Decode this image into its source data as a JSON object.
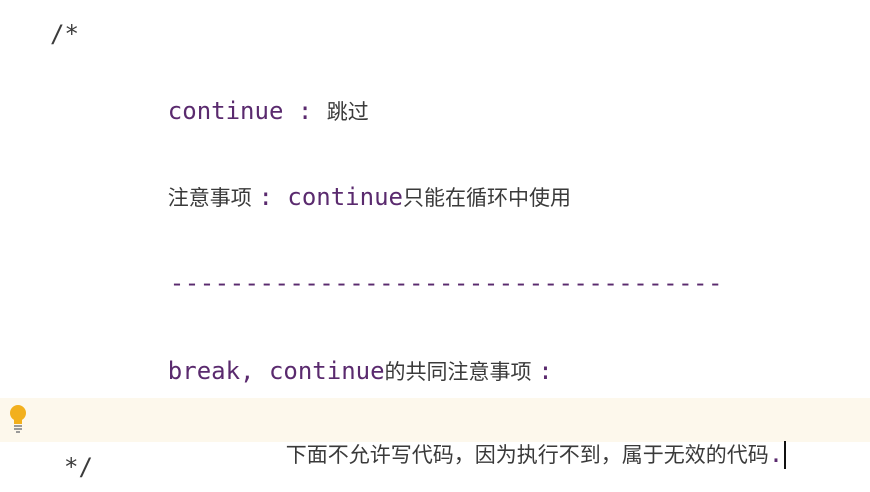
{
  "code": {
    "comment_open": "/*",
    "comment_close": "*/",
    "line1_kw": "continue : ",
    "line1_cn": "跳过",
    "line2_cn_a": "注意事项 ",
    "line2_kw": ": continue",
    "line2_cn_b": "只能在循环中使用",
    "separator": "-------------------------------------",
    "line4_kw": "break, continue",
    "line4_cn": "的共同注意事项 ",
    "line4_colon": ":",
    "line5_cn": "下面不允许写代码，因为执行不到，属于无效的代码",
    "line5_end": "."
  },
  "colors": {
    "keyword": "#5a2a6e",
    "comment_text": "#3a3a3a",
    "current_line": "#fdf8ec",
    "bulb": "#f2b01e"
  },
  "icons": {
    "gutter": "lightbulb-icon"
  }
}
